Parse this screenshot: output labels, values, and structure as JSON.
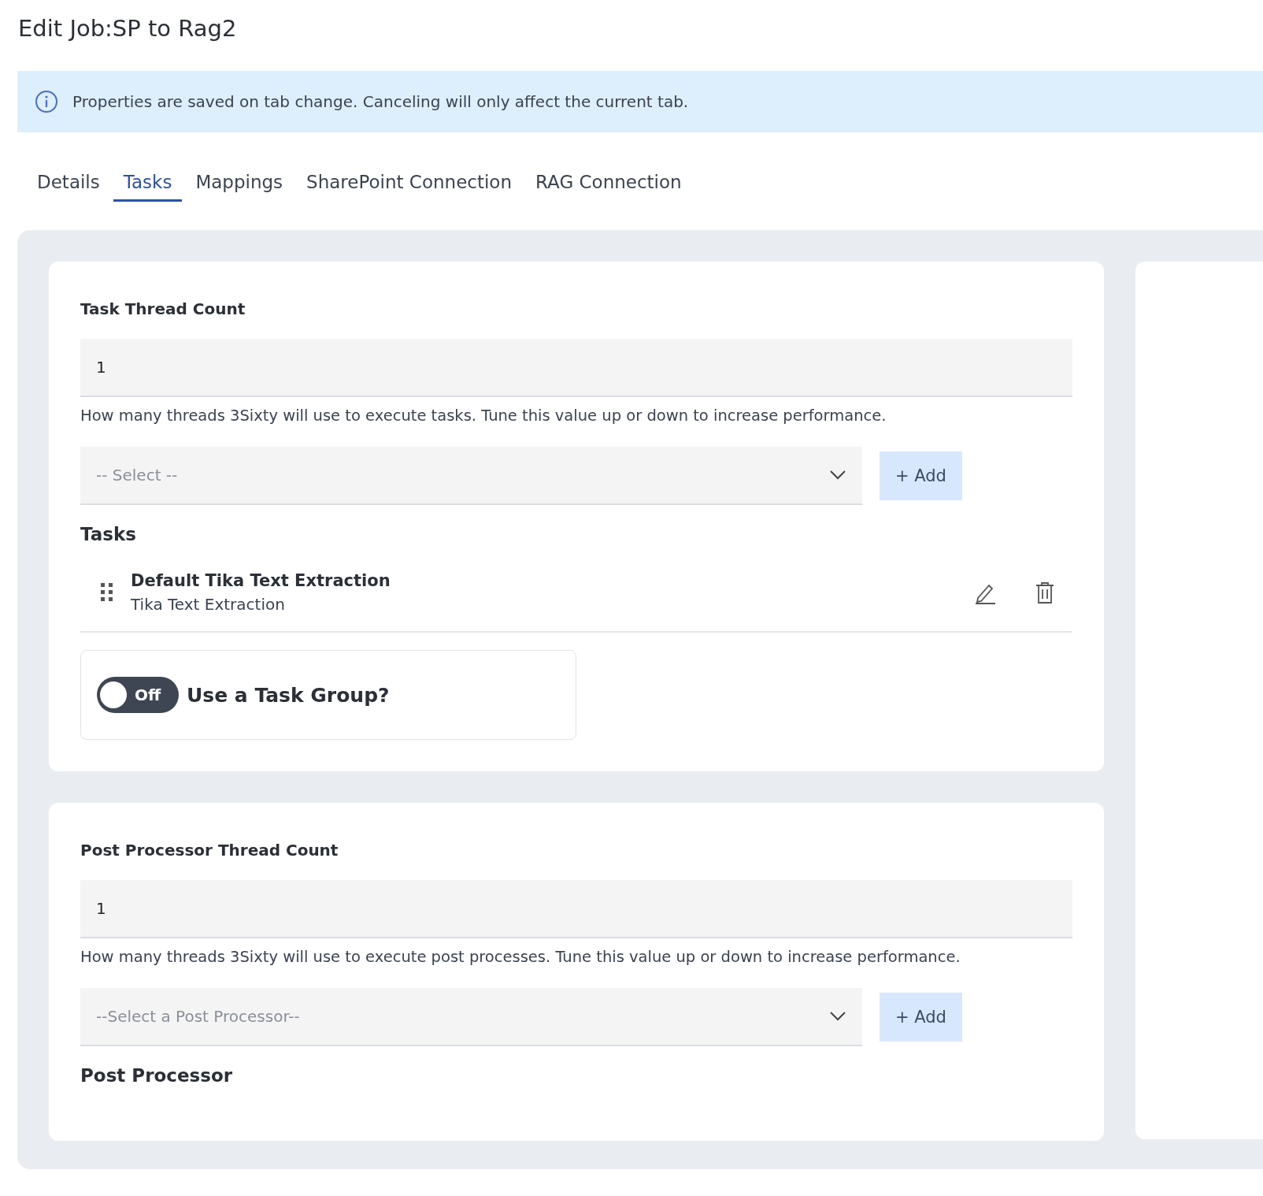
{
  "page": {
    "title": "Edit Job:SP to Rag2"
  },
  "info_banner": {
    "text": "Properties are saved on tab change. Canceling will only affect the current tab."
  },
  "tabs": [
    {
      "label": "Details",
      "selected": false
    },
    {
      "label": "Tasks",
      "selected": true
    },
    {
      "label": "Mappings",
      "selected": false
    },
    {
      "label": "SharePoint Connection",
      "selected": false
    },
    {
      "label": "RAG Connection",
      "selected": false
    }
  ],
  "task_section": {
    "label": "Task Thread Count",
    "value": "1",
    "help": "How many threads 3Sixty will use to execute tasks. Tune this value up or down to increase performance.",
    "select_placeholder": "-- Select --",
    "add_button": "+ Add",
    "list_title": "Tasks",
    "tasks": [
      {
        "name": "Default Tika Text Extraction",
        "type": "Tika Text Extraction"
      }
    ],
    "task_group_toggle": {
      "on": false,
      "state_label": "Off",
      "label": "Use a Task Group?"
    }
  },
  "post_processor_section": {
    "label": "Post Processor Thread Count",
    "value": "1",
    "help": "How many threads 3Sixty will use to execute post processes. Tune this value up or down to increase performance.",
    "select_placeholder": "--Select a Post Processor--",
    "add_button": "+ Add",
    "list_title": "Post Processor"
  }
}
